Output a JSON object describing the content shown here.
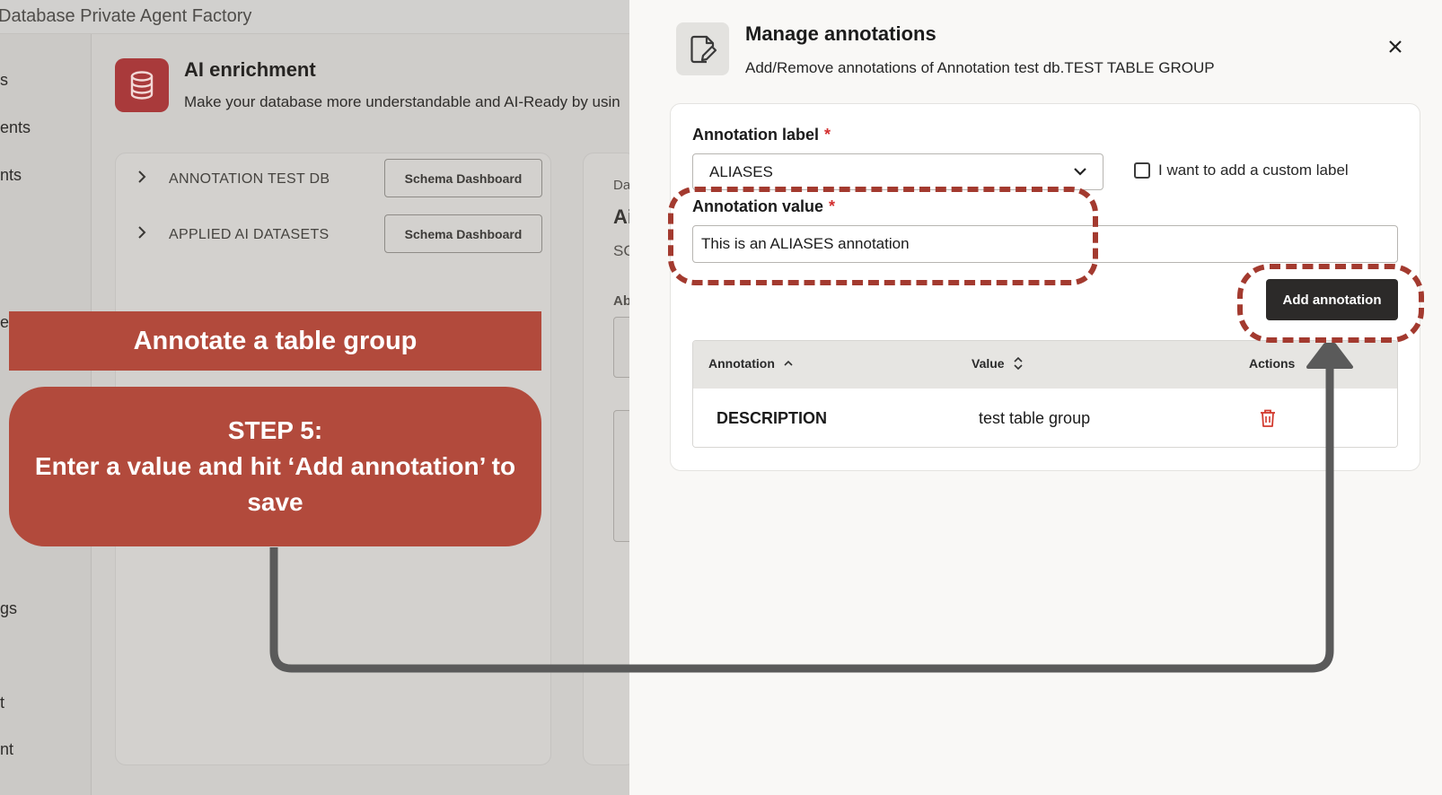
{
  "background_app": {
    "app_title": "Database Private Agent Factory",
    "sidebar_fragments": [
      "s",
      "ents",
      "nts",
      "e",
      "gs",
      "t",
      "nt"
    ],
    "header": {
      "title": "AI enrichment",
      "subtitle": "Make your database more understandable and AI-Ready by usin"
    },
    "tree": [
      {
        "label": "ANNOTATION TEST DB",
        "button": "Schema Dashboard"
      },
      {
        "label": "APPLIED AI DATASETS",
        "button": "Schema Dashboard"
      }
    ],
    "peek": {
      "small": "Da",
      "big": "Ai",
      "code": "SC",
      "about": "Ab"
    }
  },
  "tutorial": {
    "banner": "Annotate a table group",
    "step_title": "STEP 5:",
    "step_text": "Enter a value and hit ‘Add annotation’ to save",
    "highlight_color": "#a33a2f",
    "card_color": "#b24a3c"
  },
  "drawer": {
    "icon": "edit-document-icon",
    "title": "Manage annotations",
    "subtitle": "Add/Remove annotations of Annotation test db.TEST TABLE GROUP",
    "close_icon": "close-icon",
    "form": {
      "label_field": {
        "label": "Annotation label",
        "required_mark": "*",
        "selected": "ALIASES"
      },
      "custom_label_checkbox": {
        "label": "I want to add a custom label",
        "checked": false
      },
      "value_field": {
        "label": "Annotation value",
        "required_mark": "*",
        "value": "This is an ALIASES annotation"
      },
      "add_button": "Add annotation"
    },
    "table": {
      "columns": [
        "Annotation",
        "Value",
        "Actions"
      ],
      "rows": [
        {
          "annotation": "DESCRIPTION",
          "value": "test table group",
          "action_icon": "trash-icon"
        }
      ]
    }
  }
}
